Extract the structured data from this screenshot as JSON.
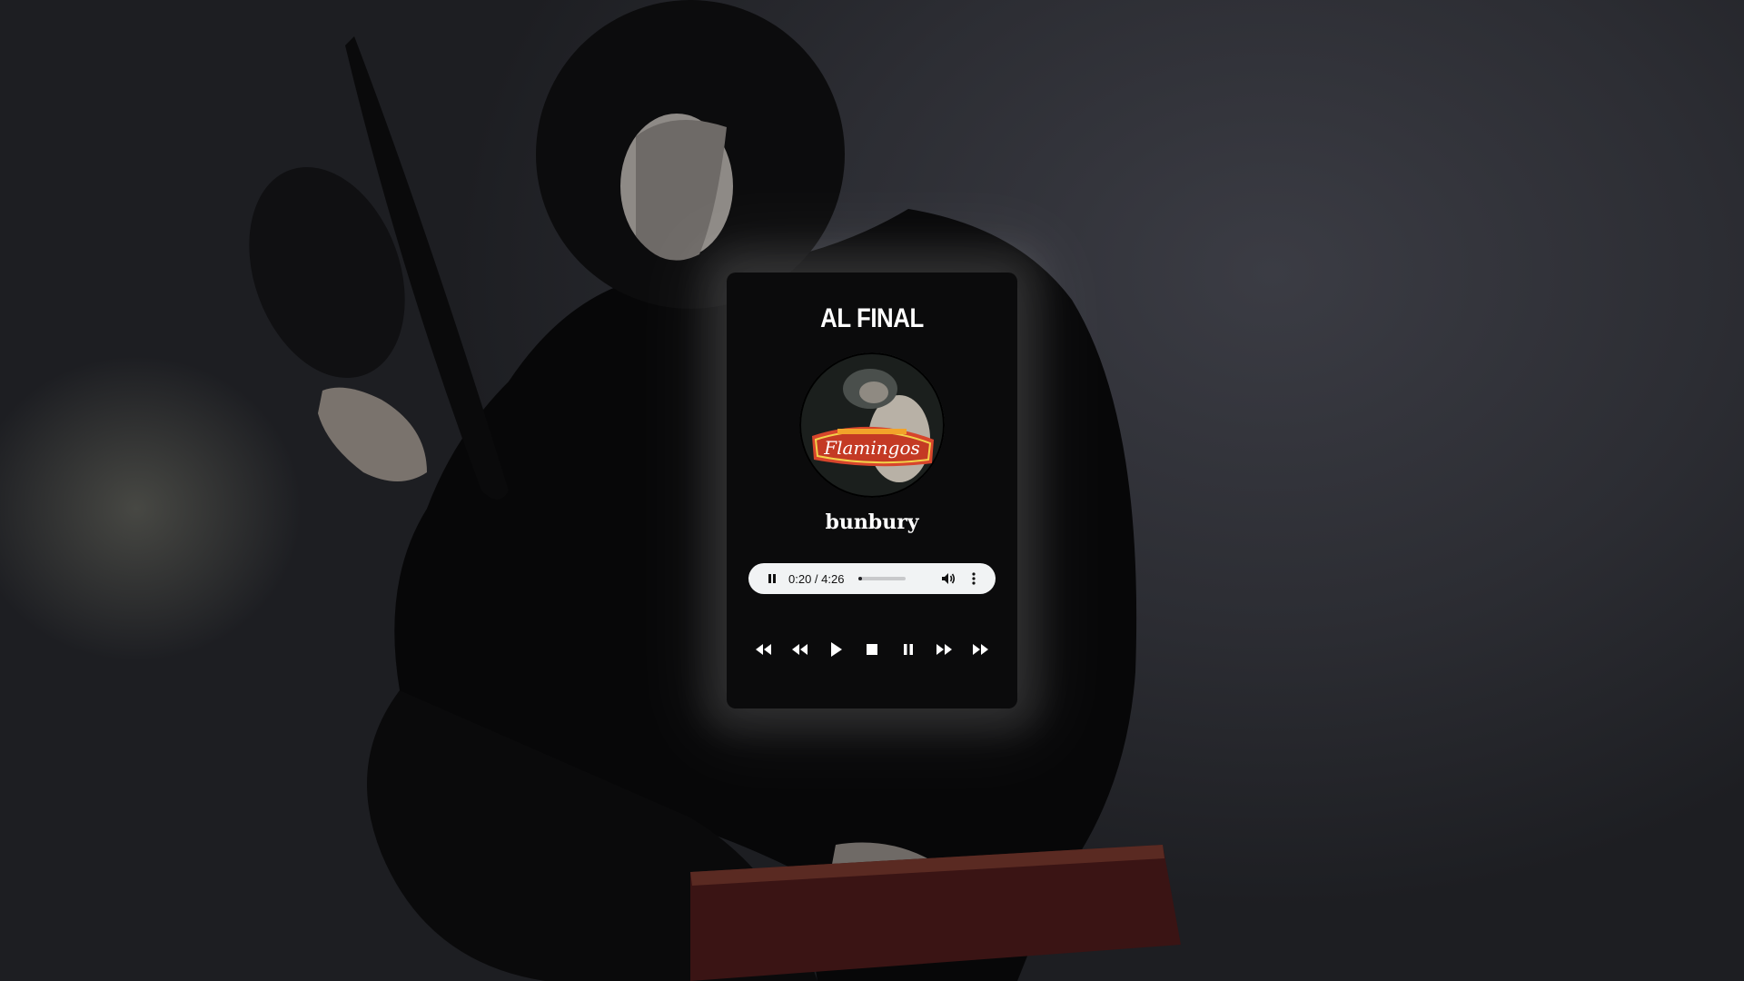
{
  "player": {
    "song_title": "AL FINAL",
    "artist": "bunbury",
    "cover_alt": "Flamingos album cover",
    "audio": {
      "state": "playing",
      "time_display": "0:20 / 4:26",
      "progress": 0.075
    },
    "transport_buttons": [
      {
        "name": "skip-to-start-icon"
      },
      {
        "name": "rewind-icon"
      },
      {
        "name": "play-icon"
      },
      {
        "name": "stop-icon"
      },
      {
        "name": "pause-icon"
      },
      {
        "name": "fast-forward-icon"
      },
      {
        "name": "skip-to-end-icon"
      }
    ]
  },
  "colors": {
    "player_bg": "#0b0b0c",
    "audio_bar_bg": "#f1f3f4",
    "text": "#ffffff"
  }
}
